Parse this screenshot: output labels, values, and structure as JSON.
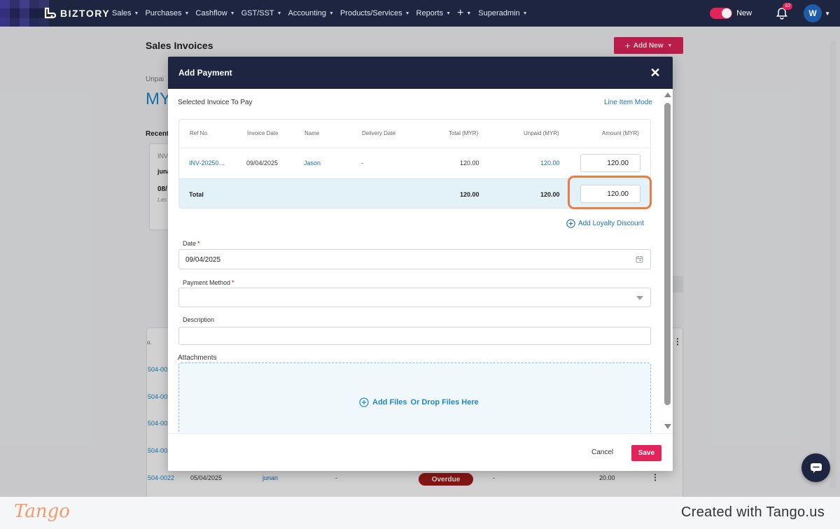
{
  "topnav": {
    "brand": "BIZTORY",
    "menu": [
      {
        "label": "Sales"
      },
      {
        "label": "Purchases"
      },
      {
        "label": "Cashflow"
      },
      {
        "label": "GST/SST"
      },
      {
        "label": "Accounting"
      },
      {
        "label": "Products/Services"
      },
      {
        "label": "Reports"
      }
    ],
    "plus_icon": "+",
    "superadmin": "Superadmin",
    "new_toggle_label": "New",
    "notification_count": "10",
    "avatar_initial": "W"
  },
  "page": {
    "title": "Sales Invoices",
    "add_new_label": "Add New",
    "unpaid_partial": "Unpai",
    "currency_partial": "MY",
    "recent_partial": "Recent",
    "card": {
      "line1": "INV",
      "line2": "juna",
      "line3": "08/",
      "line4": "Las"
    },
    "table_header_partial": "o.",
    "rows": [
      {
        "ref": "504-002"
      },
      {
        "ref": "504-002"
      },
      {
        "ref": "504-002"
      },
      {
        "ref": "504-002"
      },
      {
        "ref": "504-0022",
        "date": "05/04/2025",
        "customer": "junan",
        "dash1": "-",
        "status": "Overdue",
        "dash2": "-",
        "amount": "20.00"
      }
    ]
  },
  "modal": {
    "title": "Add Payment",
    "section_label": "Selected Invoice To Pay",
    "line_item_mode": "Line Item Mode",
    "table": {
      "headers": [
        "Ref No.",
        "Invoice Date",
        "Name",
        "Delivery Date",
        "Total (MYR)",
        "Unpaid (MYR)",
        "Amount (MYR)"
      ],
      "row": {
        "ref": "INV-20250…",
        "invoice_date": "09/04/2025",
        "name": "Jason",
        "delivery_date": "-",
        "total": "120.00",
        "unpaid": "120.00",
        "amount": "120.00"
      },
      "total_row": {
        "label": "Total",
        "total": "120.00",
        "unpaid": "120.00",
        "amount": "120.00"
      }
    },
    "add_loyalty_discount": "Add Loyalty Discount",
    "date_label": "Date",
    "date_value": "09/04/2025",
    "payment_method_label": "Payment Method",
    "description_label": "Description",
    "required_mark": "*",
    "attachments_label": "Attachments",
    "add_files": "Add Files",
    "drop_files": "Or Drop Files Here",
    "cancel_label": "Cancel",
    "save_label": "Save"
  },
  "footer": {
    "logo": "Tango",
    "credit": "Created with Tango.us"
  },
  "colors": {
    "navy": "#1d2541",
    "accent": "#e3245a",
    "link": "#1e6fb5",
    "highlight": "#ee7b45",
    "total_row_bg": "#e3f1f8",
    "overdue": "#a11c1c"
  }
}
